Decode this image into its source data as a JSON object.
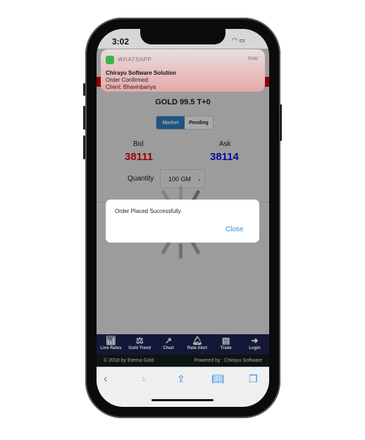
{
  "status_bar": {
    "time": "3:02"
  },
  "notification": {
    "app": "WHATSAPP",
    "time": "now",
    "title": "Chirayu Software Solution",
    "lines": [
      "Order Confirmed:",
      "Client: Bhavinbariya"
    ]
  },
  "instrument": "GOLD 99.5 T+0",
  "order_type": {
    "options": [
      "Market",
      "Pending"
    ],
    "selected": "Market"
  },
  "bid": {
    "label": "Bid",
    "value": "38111",
    "color": "#b00000"
  },
  "ask": {
    "label": "Ask",
    "value": "38114",
    "color": "#0a0aa0"
  },
  "quantity": {
    "label": "Quantity",
    "value": "100 GM"
  },
  "dialog": {
    "message": "Order Placed Successfully",
    "close_label": "Close"
  },
  "nav": [
    {
      "label": "Live Rates",
      "icon": "bar-chart-icon"
    },
    {
      "label": "Gold Trend",
      "icon": "scale-icon"
    },
    {
      "label": "Chart",
      "icon": "line-chart-icon"
    },
    {
      "label": "Rate Alert",
      "icon": "bell-icon"
    },
    {
      "label": "Trade",
      "icon": "book-icon"
    },
    {
      "label": "Login",
      "icon": "sign-in-icon"
    }
  ],
  "footer": {
    "copyright": "© 2018 by Eterna Gold",
    "powered": "Powered by : Chirayu Software"
  }
}
